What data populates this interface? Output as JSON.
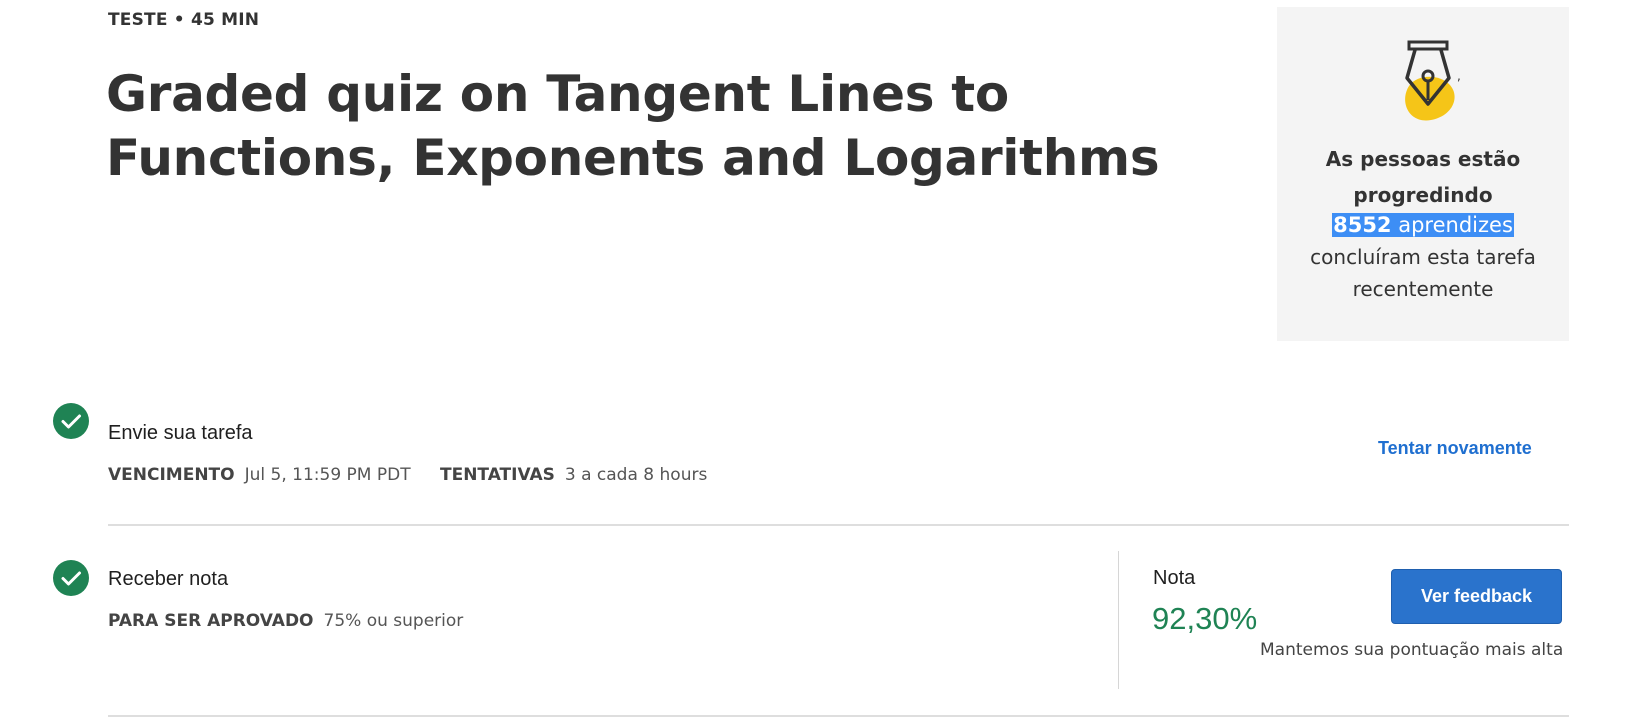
{
  "header": {
    "kicker": "TESTE • 45 MIN",
    "title": "Graded quiz on Tangent Lines to Functions, Exponents and Logarithms"
  },
  "progress_card": {
    "icon": "pen-nib-badge-icon",
    "heading": "As pessoas estão progredindo",
    "learner_count": "8552",
    "learners_label": "aprendizes",
    "rest_text": "concluíram esta tarefa recentemente"
  },
  "submit_step": {
    "title": "Envie sua tarefa",
    "due_label": "VENCIMENTO",
    "due_value": "Jul 5, 11:59 PM PDT",
    "attempts_label": "TENTATIVAS",
    "attempts_value": "3 a cada 8 hours",
    "retry_label": "Tentar novamente"
  },
  "grade_step": {
    "title": "Receber nota",
    "pass_label": "PARA SER APROVADO",
    "pass_value": "75% ou superior",
    "grade_label": "Nota",
    "grade_value": "92,30%",
    "feedback_button": "Ver feedback",
    "note": "Mantemos sua pontuação mais alta"
  },
  "colors": {
    "success": "#1f8354",
    "link": "#1f6fd0",
    "button": "#2a73cc",
    "badge_yellow": "#f5c518",
    "card_bg": "#f4f4f4"
  }
}
